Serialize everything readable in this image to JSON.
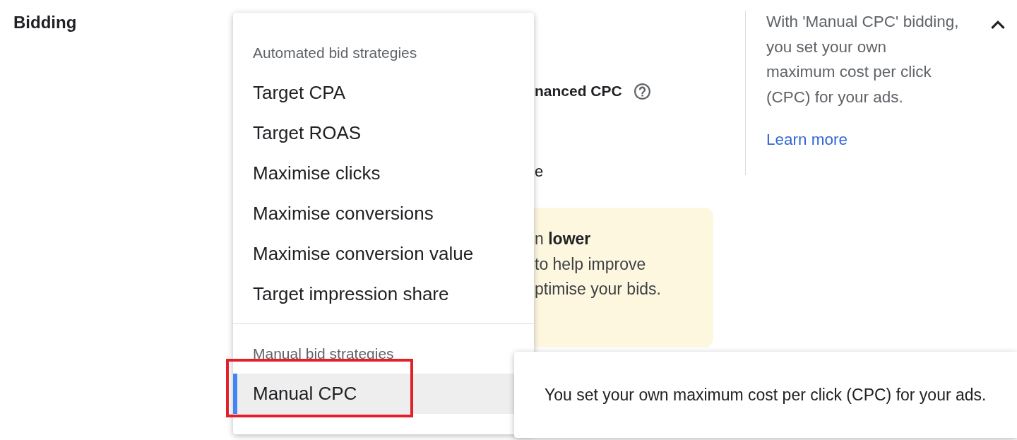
{
  "section": {
    "title": "Bidding",
    "expanded": true
  },
  "background": {
    "option_label": "nanced CPC",
    "option_text": "e",
    "notice": {
      "lines": [
        "n **lower**",
        "to help improve",
        "ptimise your bids."
      ]
    }
  },
  "help_panel": {
    "lines": [
      "With 'Manual CPC' bidding,",
      "you set your own",
      "maximum cost per click",
      "(CPC) for your ads."
    ],
    "link": "Learn more"
  },
  "dropdown": {
    "groups": [
      {
        "header": "Automated bid strategies",
        "items": [
          {
            "label": "Target CPA",
            "selected": false,
            "highlighted": false
          },
          {
            "label": "Target ROAS",
            "selected": false,
            "highlighted": false
          },
          {
            "label": "Maximise clicks",
            "selected": false,
            "highlighted": false
          },
          {
            "label": "Maximise conversions",
            "selected": false,
            "highlighted": false
          },
          {
            "label": "Maximise conversion value",
            "selected": false,
            "highlighted": false
          },
          {
            "label": "Target impression share",
            "selected": false,
            "highlighted": false
          }
        ]
      },
      {
        "header": "Manual bid strategies",
        "items": [
          {
            "label": "Manual CPC",
            "selected": true,
            "highlighted": true
          }
        ]
      }
    ]
  },
  "tooltip": {
    "text": "You set your own maximum cost per click (CPC) for your ads."
  }
}
